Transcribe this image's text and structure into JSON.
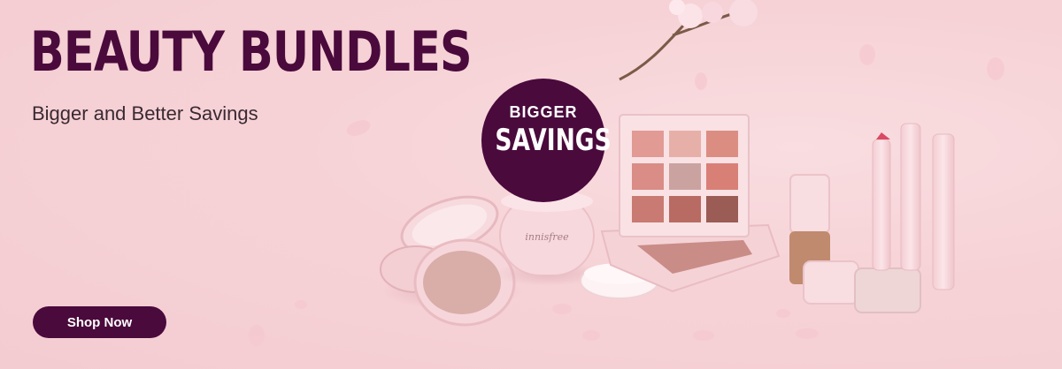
{
  "banner": {
    "headline": "BEAUTY BUNDLES",
    "subhead": "Bigger and Better Savings",
    "cta_label": "Shop Now",
    "badge": {
      "top": "BIGGER",
      "main": "SAVINGS"
    },
    "brand_mark": "innisfree"
  },
  "colors": {
    "accent": "#4a0a3c",
    "background": "#f6d2d6",
    "text": "#3a2a33"
  }
}
